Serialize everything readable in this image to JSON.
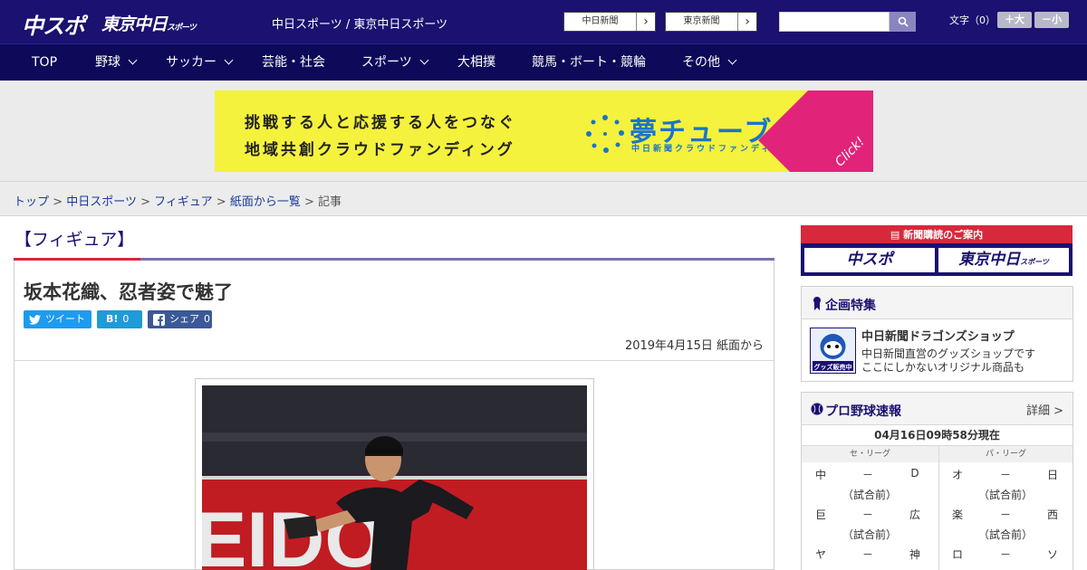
{
  "header": {
    "logo_main": "中スポ",
    "logo_tokyo": "東京中日",
    "logo_tokyo_small": "スポーツ",
    "site_title": "中日スポーツ / 東京中日スポーツ",
    "paper_links": [
      "中日新聞",
      "東京新聞"
    ],
    "search_placeholder": "",
    "font_size_label": "文字（0）",
    "font_larger": "＋大",
    "font_smaller": "－小"
  },
  "nav": {
    "items": [
      {
        "label": "TOP",
        "has_menu": false
      },
      {
        "label": "野球",
        "has_menu": true
      },
      {
        "label": "サッカー",
        "has_menu": true
      },
      {
        "label": "芸能・社会",
        "has_menu": false
      },
      {
        "label": "スポーツ",
        "has_menu": true
      },
      {
        "label": "大相撲",
        "has_menu": false
      },
      {
        "label": "競馬・ボート・競輪",
        "has_menu": false
      },
      {
        "label": "その他",
        "has_menu": true
      }
    ]
  },
  "banner": {
    "line1": "挑戦する人と応援する人をつなぐ",
    "line2": "地域共創クラウドファンディング",
    "brand": "夢チューブ",
    "brand_sub": "中日新聞クラウドファンディング",
    "click": "Click!"
  },
  "breadcrumb": {
    "items": [
      "トップ",
      "中日スポーツ",
      "フィギュア",
      "紙面から一覧"
    ],
    "separator": ">",
    "current": "記事"
  },
  "article": {
    "category": "【フィギュア】",
    "headline": "坂本花織、忍者姿で魅了",
    "share": {
      "tweet": "ツイート",
      "hatena_icon": "B!",
      "hatena_count": "0",
      "facebook": "シェア",
      "facebook_count": "0"
    },
    "dateline": "2019年4月15日 紙面から"
  },
  "sidebar": {
    "subscribe_title": "新聞購読のご案内",
    "subscribe_chuspo": "中スポ",
    "subscribe_tokyo": "東京中日",
    "subscribe_tokyo_small": "スポーツ",
    "special": {
      "title": "企画特集",
      "shop_name": "中日新聞ドラゴンズショップ",
      "shop_desc1": "中日新聞直営のグッズショップです",
      "shop_desc2": "ここにしかないオリジナル商品も",
      "shop_img_label": "グッズ販売中"
    },
    "baseball": {
      "title": "プロ野球速報",
      "detail": "詳細 >",
      "updated": "04月16日09時58分現在",
      "central_label": "セ・リーグ",
      "pacific_label": "パ・リーグ",
      "central": [
        {
          "home": "中",
          "sep": "－",
          "away": "D",
          "status": "（試合前）"
        },
        {
          "home": "巨",
          "sep": "－",
          "away": "広",
          "status": "（試合前）"
        },
        {
          "home": "ヤ",
          "sep": "－",
          "away": "神",
          "status": ""
        }
      ],
      "pacific": [
        {
          "home": "オ",
          "sep": "－",
          "away": "日",
          "status": "（試合前）"
        },
        {
          "home": "楽",
          "sep": "－",
          "away": "西",
          "status": "（試合前）"
        },
        {
          "home": "ロ",
          "sep": "－",
          "away": "ソ",
          "status": ""
        }
      ]
    }
  },
  "colors": {
    "header_bg": "#1a1170",
    "nav_bg": "#0e0a5a",
    "accent_red": "#d8283c",
    "banner_yellow": "#f4f23c",
    "brand_blue": "#1b74c9"
  }
}
